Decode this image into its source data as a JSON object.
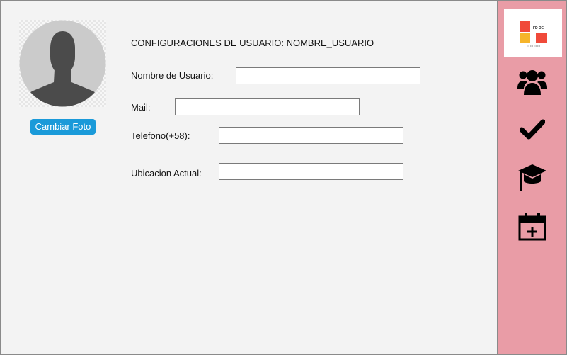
{
  "profile": {
    "change_photo_label": "Cambiar Foto"
  },
  "form": {
    "title": "CONFIGURACIONES DE USUARIO: NOMBRE_USUARIO",
    "username_label": "Nombre de Usuario:",
    "username_value": "",
    "mail_label": "Mail:",
    "mail_value": "",
    "phone_label": "Telefono(+58):",
    "phone_value": "",
    "location_label": "Ubicacion Actual:",
    "location_value": ""
  },
  "sidebar": {
    "logo": {
      "text": "FD DE"
    },
    "items": [
      {
        "icon": "users-icon"
      },
      {
        "icon": "checkmark-icon"
      },
      {
        "icon": "graduation-cap-icon"
      },
      {
        "icon": "calendar-plus-icon"
      }
    ]
  },
  "colors": {
    "sidebar_bg": "#e99ca6",
    "main_bg": "#f3f3f3",
    "button_bg": "#1a9ad9",
    "logo_red": "#f04a3a",
    "logo_orange": "#f6b52b"
  }
}
